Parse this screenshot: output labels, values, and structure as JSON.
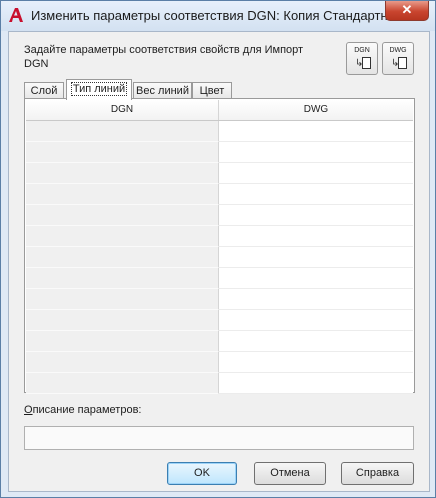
{
  "window": {
    "title": "Изменить параметры соответствия DGN:  Копия Стандартный",
    "close_label": "✕"
  },
  "description": "Задайте параметры соответствия свойств для Импорт DGN",
  "icon_buttons": [
    {
      "caption": "DGN",
      "icon": "dgn-to-dwg-icon"
    },
    {
      "caption": "DWG",
      "icon": "dwg-to-dgn-icon"
    }
  ],
  "tabs": [
    {
      "label": "Слой"
    },
    {
      "label": "Тип линий",
      "selected": true
    },
    {
      "label": "Вес линий"
    },
    {
      "label": "Цвет"
    }
  ],
  "grid": {
    "columns": [
      "DGN",
      "DWG"
    ],
    "row_count": 13
  },
  "params": {
    "label": "Описание параметров:",
    "value": ""
  },
  "buttons": {
    "ok": "OK",
    "cancel": "Отмена",
    "help": "Справка"
  },
  "colors": {
    "title_bar": "#dfe9f5",
    "close_button": "#c9452f",
    "default_button": "#bee6fd"
  }
}
